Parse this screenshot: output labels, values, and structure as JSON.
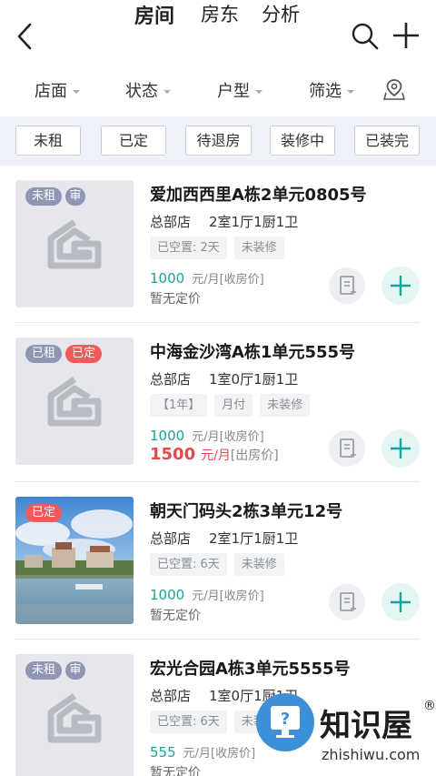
{
  "header": {
    "tabs": [
      "房间",
      "房东",
      "分析"
    ]
  },
  "filters": [
    "店面",
    "状态",
    "户型",
    "筛选"
  ],
  "chips": [
    "未租",
    "已定",
    "待退房",
    "装修中",
    "已装完"
  ],
  "cards": [
    {
      "badges": [
        "未租",
        "审"
      ],
      "title": "爱加西西里A栋2单元0805号",
      "store": "总部店",
      "layout": "2室1厅1厨1卫",
      "tags": [
        "已空置: 2天",
        "未装修"
      ],
      "price": "1000",
      "price_unit": "元/月[收房价]",
      "price2": "暂无定价"
    },
    {
      "badges": [
        "已租",
        "已定"
      ],
      "title": "中海金沙湾A栋1单元555号",
      "store": "总部店",
      "layout": "1室0厅1厨1卫",
      "tags": [
        "【1年】",
        "月付",
        "未装修"
      ],
      "price": "1000",
      "price_unit": "元/月[收房价]",
      "price2_value": "1500",
      "price2_unit": "元/月",
      "price2_note": "[出房价]"
    },
    {
      "badges": [
        "已定"
      ],
      "title": "朝天门码头2栋3单元12号",
      "store": "总部店",
      "layout": "2室1厅1厨1卫",
      "tags": [
        "已空置: 6天",
        "未装修"
      ],
      "price": "1000",
      "price_unit": "元/月[收房价]",
      "price2": "暂无定价"
    },
    {
      "badges": [
        "未租",
        "审"
      ],
      "title": "宏光合园A栋3单元5555号",
      "store": "总部店",
      "layout": "1室0厅1厨1卫",
      "tags": [
        "已空置: 6天",
        "未装修"
      ],
      "price": "555",
      "price_unit": "元/月[收房价]",
      "price2": "暂无定价"
    }
  ],
  "watermark": {
    "text": "知识屋",
    "reg": "®",
    "url": "zhishiwu.com"
  },
  "colors": {
    "accent": "#1aa39a",
    "badge_gray": "#8e96b3",
    "badge_red": "#f05a5a",
    "price_red": "#e24b4b",
    "chip_bar": "#eef2f8"
  }
}
